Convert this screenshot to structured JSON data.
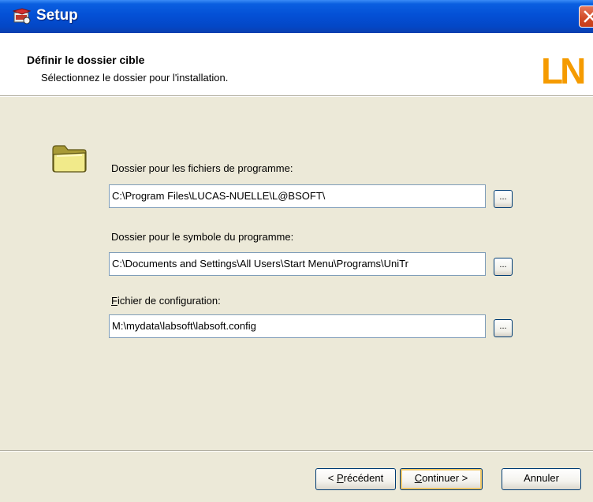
{
  "window": {
    "title": "Setup"
  },
  "header": {
    "title": "Définir le dossier cible",
    "subtitle": "Sélectionnez le dossier pour l'installation.",
    "logo_text": "LN"
  },
  "fields": [
    {
      "label": "Dossier pour les fichiers de programme:",
      "value": "C:\\Program Files\\LUCAS-NUELLE\\L@BSOFT\\",
      "browse_label": "..."
    },
    {
      "label": "Dossier pour le symbole du programme:",
      "value": "C:\\Documents and Settings\\All Users\\Start Menu\\Programs\\UniTr",
      "browse_label": "..."
    },
    {
      "label_mnemonic": "F",
      "label_rest": "ichier de configuration:",
      "value": "M:\\mydata\\labsoft\\labsoft.config",
      "browse_label": "..."
    }
  ],
  "buttons": {
    "back_prefix": "< ",
    "back_mnemonic": "P",
    "back_rest": "récédent",
    "next_mnemonic": "C",
    "next_rest": "ontinuer >",
    "cancel": "Annuler"
  },
  "colors": {
    "titlebar": "#0450d6",
    "dialog_bg": "#ece9d8",
    "close_button": "#d14a24",
    "logo": "#f59b00"
  },
  "icons": [
    "setup-app-icon",
    "close-icon",
    "folder-icon"
  ]
}
